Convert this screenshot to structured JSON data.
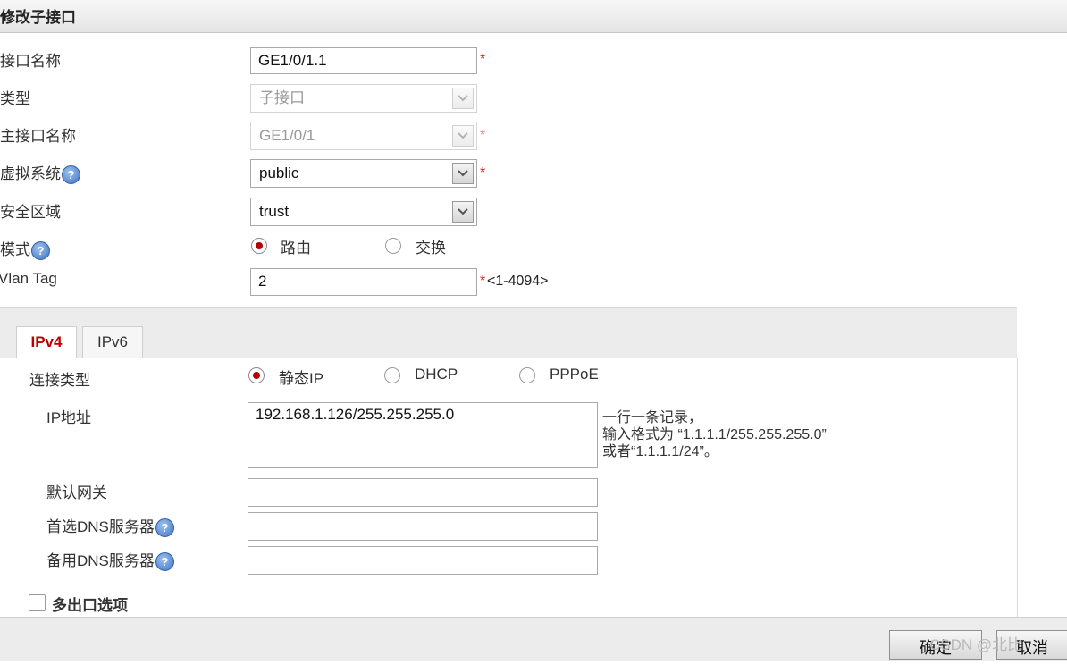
{
  "dialog": {
    "title": "修改子接口"
  },
  "form": {
    "interface_name": {
      "label": "接口名称",
      "value": "GE1/0/1.1",
      "required": "*"
    },
    "type": {
      "label": "类型",
      "value": "子接口"
    },
    "parent_interface": {
      "label": "主接口名称",
      "value": "GE1/0/1",
      "required": "*"
    },
    "virtual_system": {
      "label": "虚拟系统",
      "value": "public",
      "required": "*"
    },
    "security_zone": {
      "label": "安全区域",
      "value": "trust"
    },
    "mode": {
      "label": "模式",
      "options": [
        "路由",
        "交换"
      ],
      "selected": "路由"
    },
    "vlan_tag": {
      "label": "Vlan Tag",
      "value": "2",
      "required": "*",
      "range": "<1-4094>"
    }
  },
  "tabs": [
    {
      "label": "IPv4",
      "active": true
    },
    {
      "label": "IPv6",
      "active": false
    }
  ],
  "ipv4": {
    "connection_type": {
      "label": "连接类型",
      "options": [
        "静态IP",
        "DHCP",
        "PPPoE"
      ],
      "selected": "静态IP"
    },
    "ip_address": {
      "label": "IP地址",
      "value": "192.168.1.126/255.255.255.0",
      "hint": [
        "一行一条记录，",
        "输入格式为 “1.1.1.1/255.255.255.0”",
        "或者“1.1.1.1/24”。"
      ]
    },
    "default_gateway": {
      "label": "默认网关",
      "value": ""
    },
    "primary_dns": {
      "label": "首选DNS服务器",
      "value": ""
    },
    "secondary_dns": {
      "label": "备用DNS服务器",
      "value": ""
    },
    "multi_egress": {
      "label": "多出口选项",
      "checked": false
    }
  },
  "help_icon": "?",
  "footer": {
    "ok_label": "确定",
    "cancel_label": "取消"
  },
  "watermark": "CSDN @北比",
  "colors": {
    "required": "#e02020",
    "radio_selected": "#b40000",
    "active_tab_text": "#c00000",
    "help_icon": "#3c72c4"
  },
  "icons": [
    "help-icon",
    "chevron-down-icon"
  ]
}
